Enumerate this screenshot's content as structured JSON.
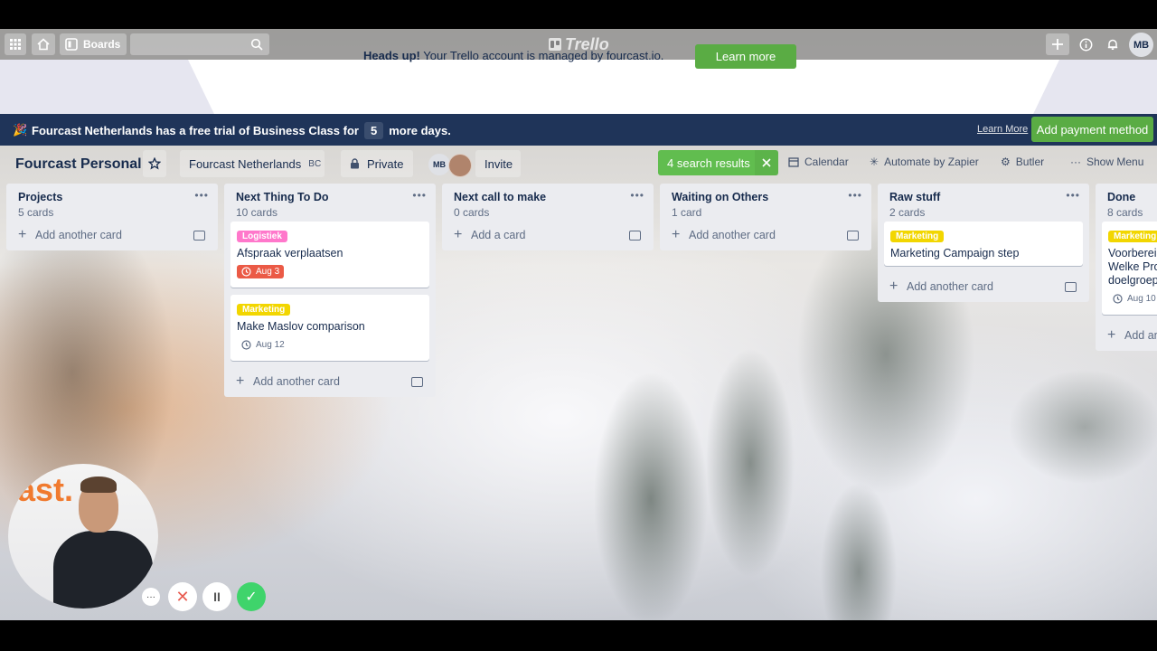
{
  "topnav": {
    "apps_icon": "grid-icon",
    "home_icon": "home-icon",
    "boards_label": "Boards",
    "search_placeholder": "",
    "logo_text": "Trello"
  },
  "headsup": {
    "bold": "Heads up!",
    "message": "Your Trello account is managed by fourcast.io.",
    "button": "Learn more"
  },
  "trial": {
    "prefix": "Fourcast Netherlands has a free trial of Business Class for",
    "days": "5",
    "suffix": "more days.",
    "learn_link": "Learn More",
    "pay_button": "Add payment method"
  },
  "board": {
    "title": "Fourcast Personal",
    "team": "Fourcast Netherlands",
    "team_badge": "BC",
    "visibility": "Private",
    "member_initials": "MB",
    "invite": "Invite",
    "search_results": "4 search results",
    "calendar": "Calendar",
    "automate": "Automate by Zapier",
    "butler": "Butler",
    "show_menu": "Show Menu"
  },
  "lists": [
    {
      "name": "Projects",
      "count": "5 cards",
      "add": "Add another card",
      "cards": []
    },
    {
      "name": "Next Thing To Do",
      "count": "10 cards",
      "add": "Add another card",
      "cards": [
        {
          "label": "Logistiek",
          "label_color": "#ff78cb",
          "title": "Afspraak verplaatsen",
          "due": "Aug 3",
          "due_state": "overdue"
        },
        {
          "label": "Marketing",
          "label_color": "#f2d600",
          "title": "Make Maslov comparison",
          "due": "Aug 12",
          "due_state": "normal"
        }
      ]
    },
    {
      "name": "Next call to make",
      "count": "0 cards",
      "add": "Add a card",
      "cards": []
    },
    {
      "name": "Waiting on Others",
      "count": "1 card",
      "add": "Add another card",
      "cards": []
    },
    {
      "name": "Raw stuff",
      "count": "2 cards",
      "add": "Add another card",
      "cards": [
        {
          "label": "Marketing",
          "label_color": "#f2d600",
          "title": "Marketing Campaign step"
        }
      ]
    },
    {
      "name": "Done",
      "count": "8 cards",
      "add": "Add an",
      "cards": [
        {
          "label": "Marketing",
          "label_color": "#f2d600",
          "title_lines": [
            "Voorbereid",
            "Welke Proc",
            "doelgroep"
          ],
          "due": "Aug 10"
        }
      ]
    }
  ],
  "recorder": {
    "brand_text": "ast.",
    "more": "···",
    "cancel": "✕",
    "pause": "II",
    "finish": "✓"
  }
}
